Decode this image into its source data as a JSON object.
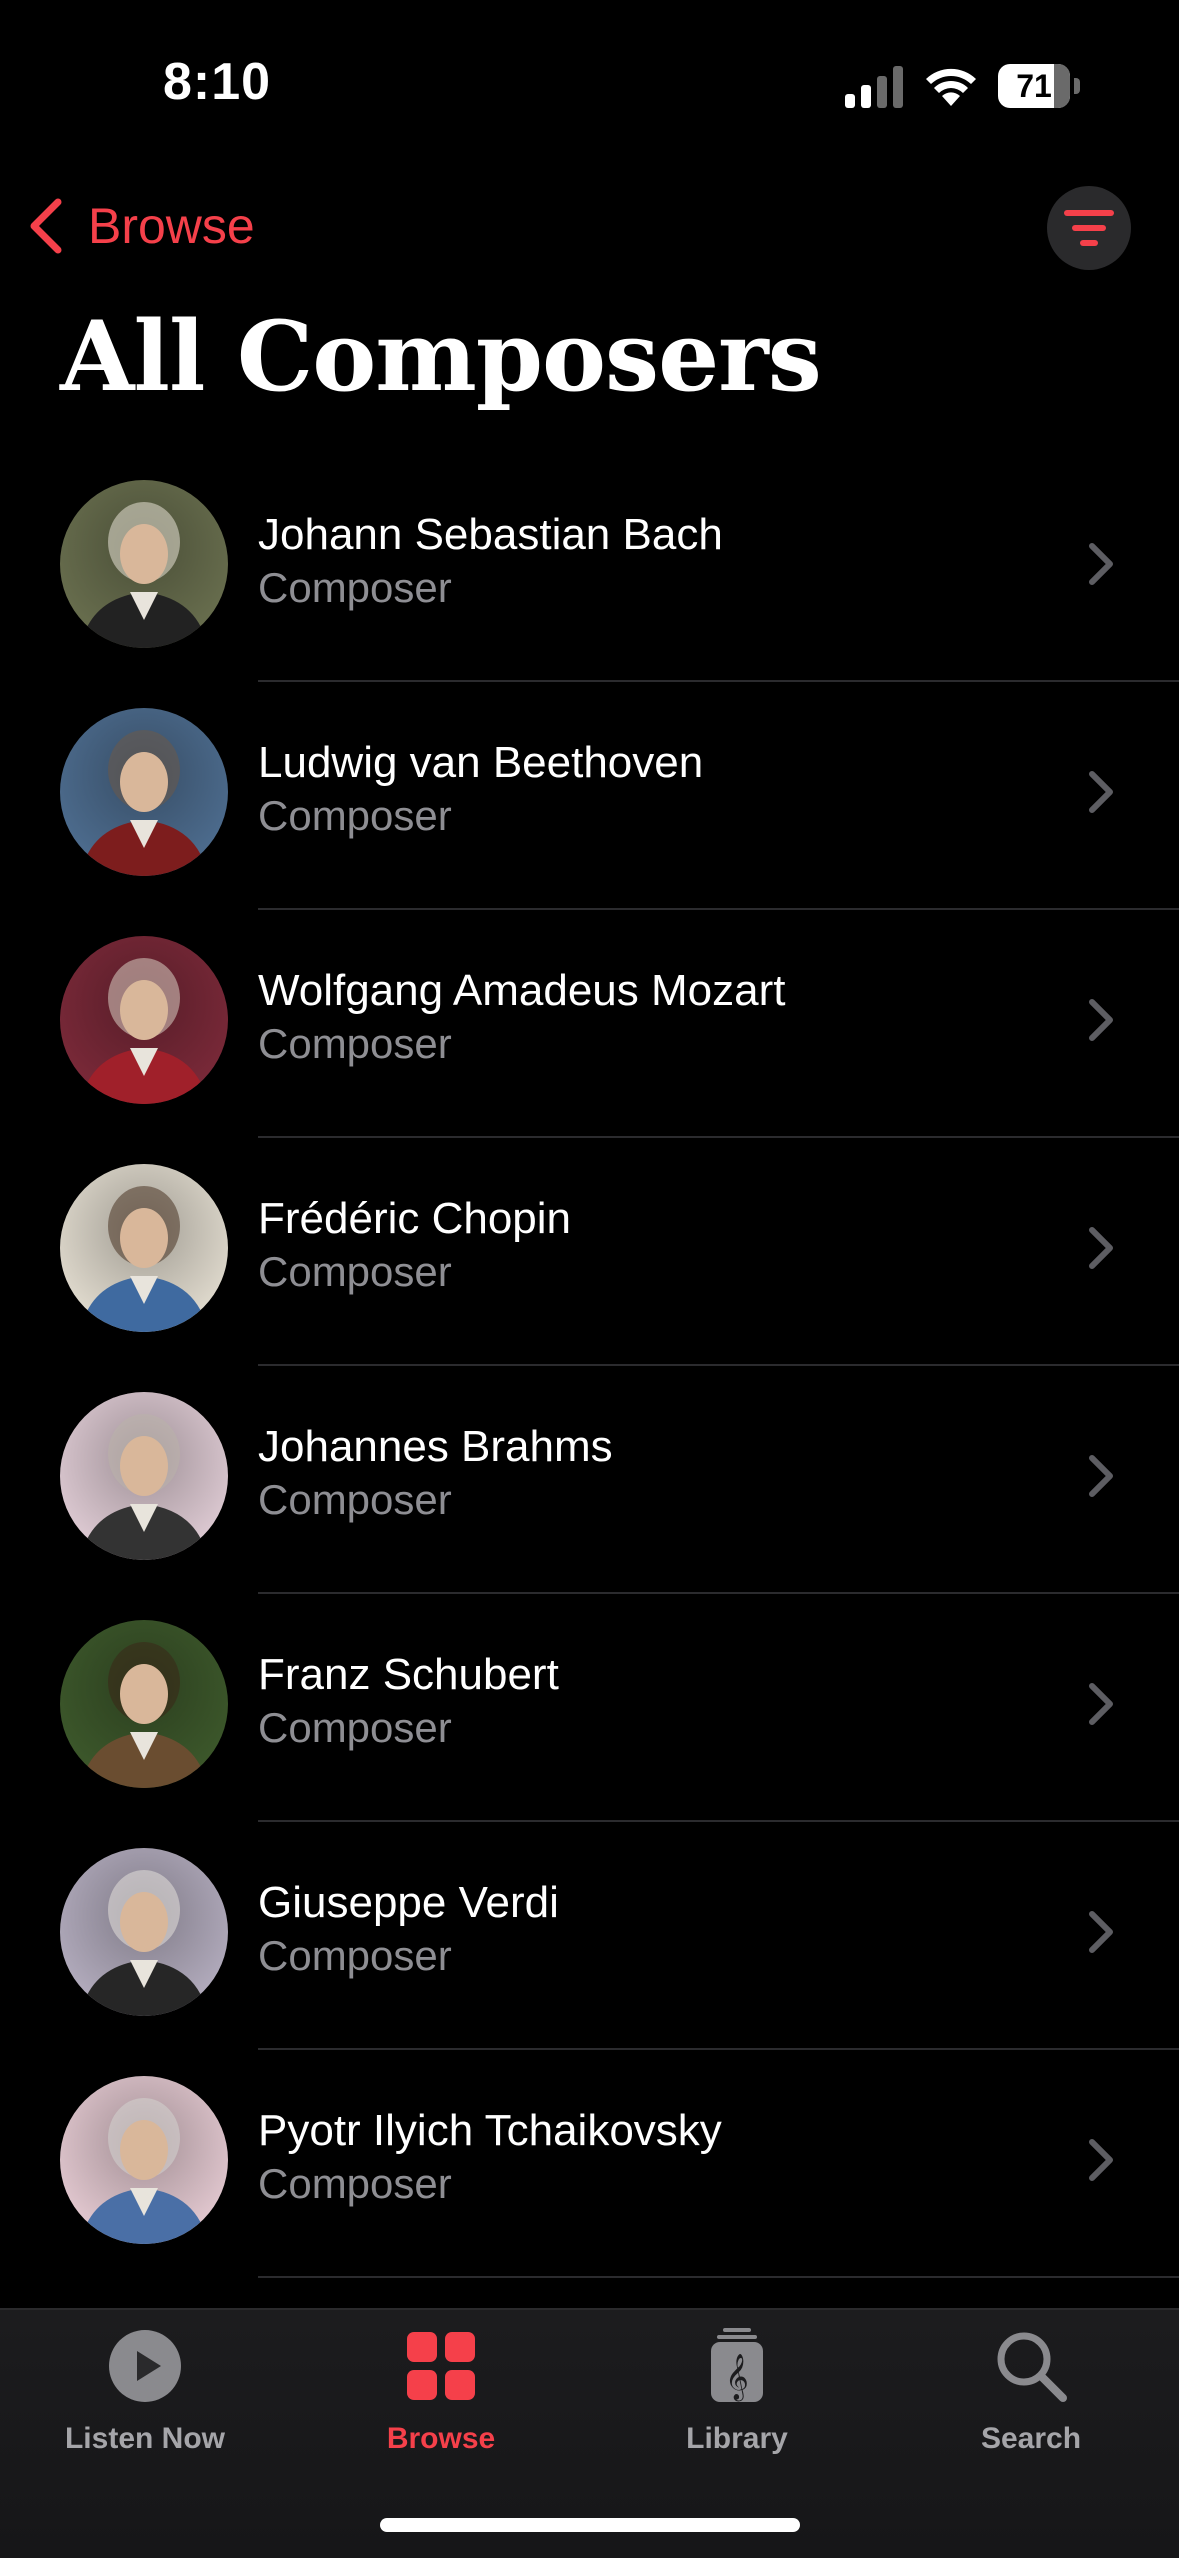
{
  "status": {
    "time": "8:10",
    "battery": "71"
  },
  "nav": {
    "back_label": "Browse"
  },
  "page": {
    "title": "All Composers"
  },
  "composers": [
    {
      "name": "Johann Sebastian Bach",
      "role": "Composer",
      "colors": [
        "#6b7150",
        "#e8e2d6",
        "#222"
      ]
    },
    {
      "name": "Ludwig van Beethoven",
      "role": "Composer",
      "colors": [
        "#4f6f92",
        "#6b5a48",
        "#7d1d1d"
      ]
    },
    {
      "name": "Wolfgang Amadeus Mozart",
      "role": "Composer",
      "colors": [
        "#7d2a3a",
        "#d8d0c2",
        "#a0202a"
      ]
    },
    {
      "name": "Frédéric Chopin",
      "role": "Composer",
      "colors": [
        "#e6e0d3",
        "#4a3524",
        "#3f6aa0"
      ]
    },
    {
      "name": "Johannes Brahms",
      "role": "Composer",
      "colors": [
        "#e3cfd8",
        "#b9b3aa",
        "#333"
      ]
    },
    {
      "name": "Franz Schubert",
      "role": "Composer",
      "colors": [
        "#3e5a2c",
        "#3a2718",
        "#6a4d30"
      ]
    },
    {
      "name": "Giuseppe Verdi",
      "role": "Composer",
      "colors": [
        "#b7b0c2",
        "#e4e0da",
        "#262626"
      ]
    },
    {
      "name": "Pyotr Ilyich Tchaikovsky",
      "role": "Composer",
      "colors": [
        "#e8cdd5",
        "#d3d3d0",
        "#4a6fa6"
      ]
    }
  ],
  "tabs": [
    {
      "label": "Listen Now",
      "icon": "play-circle-icon",
      "active": false
    },
    {
      "label": "Browse",
      "icon": "grid-icon",
      "active": true
    },
    {
      "label": "Library",
      "icon": "library-icon",
      "active": false
    },
    {
      "label": "Search",
      "icon": "search-icon",
      "active": false
    }
  ],
  "theme": {
    "accent": "#f5404a"
  }
}
